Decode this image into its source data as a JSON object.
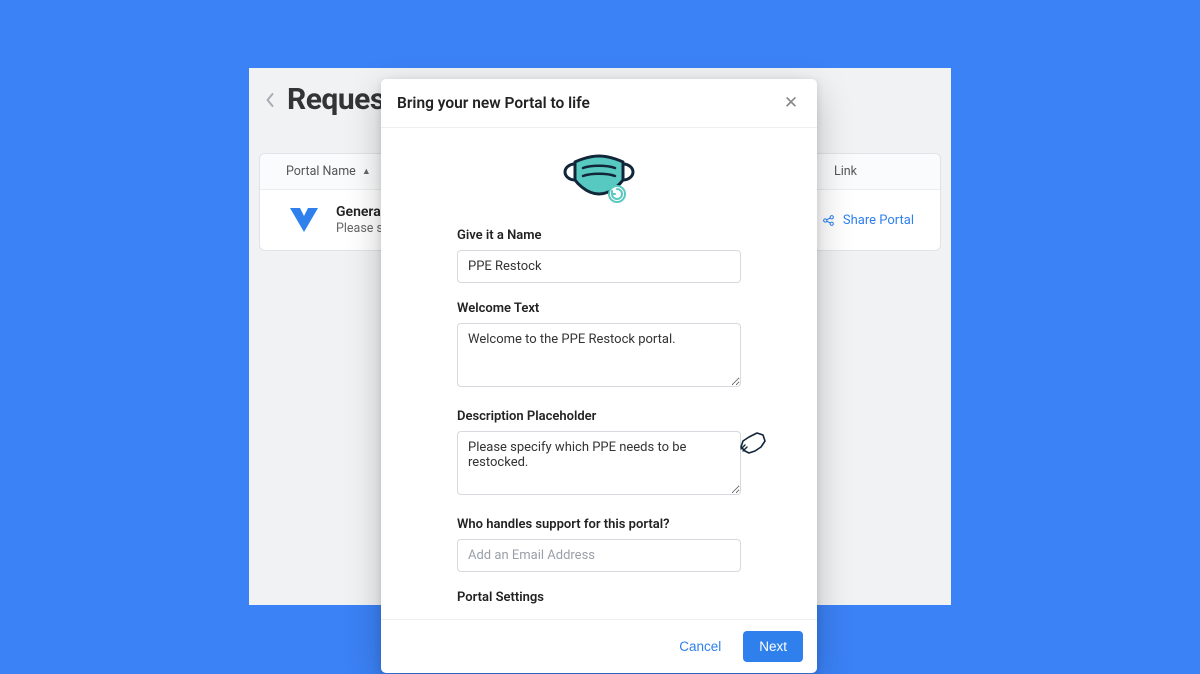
{
  "page": {
    "title": "Request Portals"
  },
  "table": {
    "header": {
      "name": "Portal Name",
      "link": "Link"
    },
    "row": {
      "title": "General Requests",
      "subtitle": "Please submit your request here.",
      "share": "Share Portal"
    }
  },
  "modal": {
    "title": "Bring your new Portal to life",
    "name_label": "Give it a Name",
    "name_value": "PPE Restock",
    "welcome_label": "Welcome Text",
    "welcome_value": "Welcome to the PPE Restock portal.",
    "desc_label": "Description Placeholder",
    "desc_value": "Please specify which PPE needs to be restocked.",
    "support_label": "Who handles support for this portal?",
    "support_placeholder": "Add an Email Address",
    "settings_label": "Portal Settings",
    "cancel": "Cancel",
    "next": "Next"
  }
}
